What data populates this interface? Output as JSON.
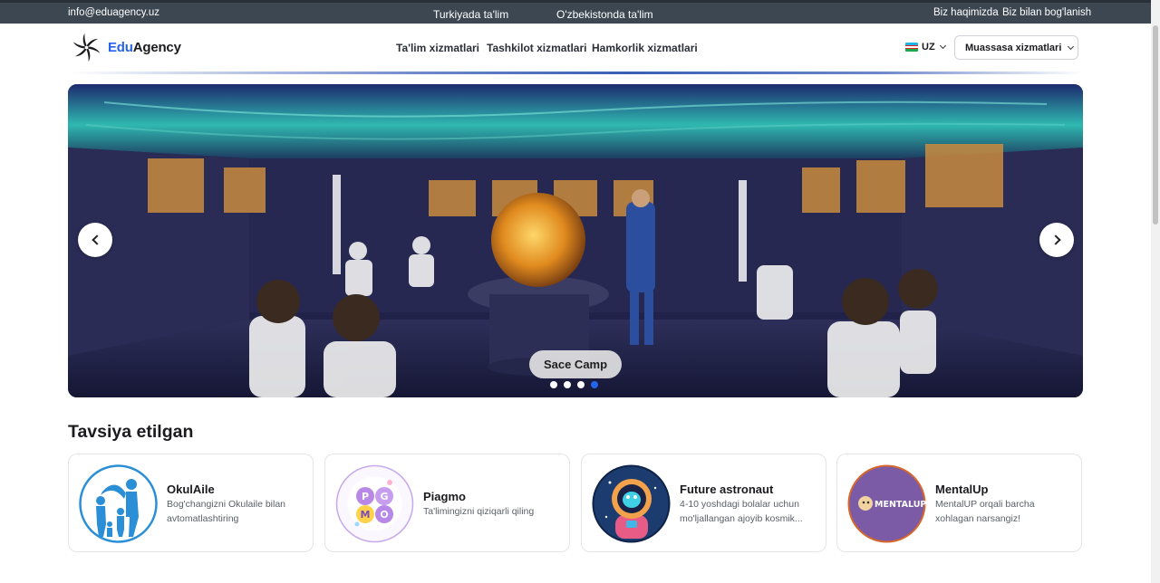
{
  "topbar": {
    "email": "info@eduagency.uz",
    "links_center": [
      "Turkiyada ta'lim",
      "O'zbekistonda ta'lim"
    ],
    "links_right": [
      "Biz haqimizda",
      "Biz bilan bog'lanish"
    ]
  },
  "header": {
    "logo_edu": "Edu",
    "logo_agency": "Agency",
    "nav": [
      "Ta'lim xizmatlari",
      "Tashkilot xizmatlari",
      "Hamkorlik xizmatlari"
    ],
    "language": "UZ",
    "institution_button": "Muassasa xizmatlari"
  },
  "hero": {
    "caption": "Sace Camp",
    "slide_count": 4,
    "active_slide": 4
  },
  "recommended": {
    "title": "Tavsiya etilgan",
    "cards": [
      {
        "title": "OkulAile",
        "description": "Bog'changizni Okulaile bilan avtomatlashtiring",
        "icon": "family-logo-icon"
      },
      {
        "title": "Piagmo",
        "description": "Ta'limingizni qiziqarli qiling",
        "icon": "piagmo-logo-icon"
      },
      {
        "title": "Future astronaut",
        "description": "4-10 yoshdagi bolalar uchun mo'ljallangan ajoyib kosmik...",
        "icon": "astronaut-icon"
      },
      {
        "title": "MentalUp",
        "description": "MentalUP orqali barcha xohlagan narsangiz!",
        "icon": "mentalup-logo-icon",
        "logo_text": "MENTALUP"
      }
    ]
  },
  "colors": {
    "accent": "#2563eb",
    "topbar_bg": "#3d4752",
    "mentalup_purple": "#7b5aa6"
  }
}
